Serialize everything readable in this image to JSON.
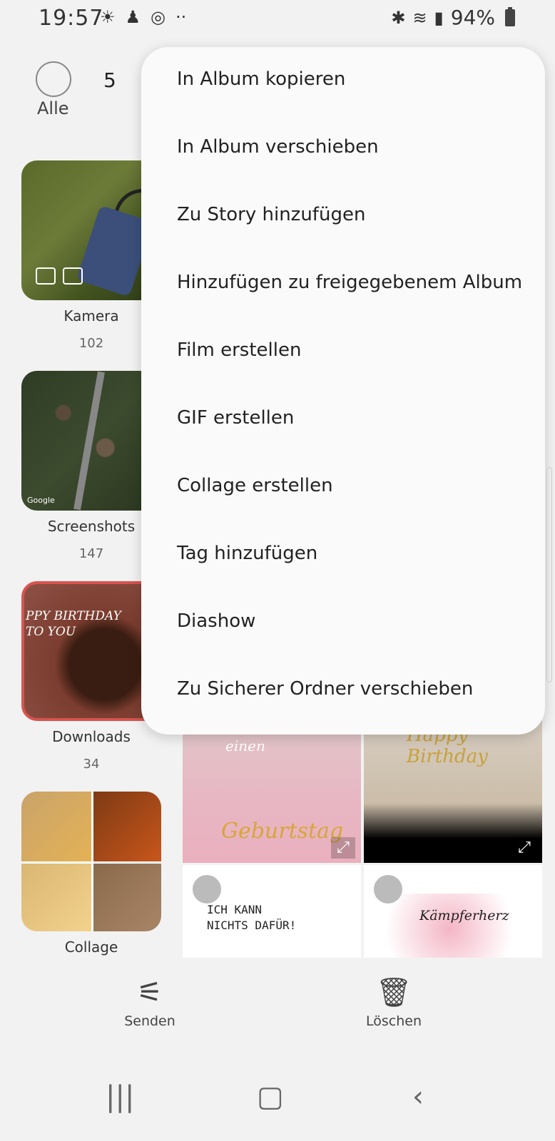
{
  "status_bar": {
    "time": "19:57",
    "left_icons": [
      "weather-icon",
      "figure-icon",
      "nfc-icon",
      "more-dots"
    ],
    "battery": "94%"
  },
  "selection": {
    "all_label": "Alle",
    "count": "5"
  },
  "albums": [
    {
      "name": "Kamera",
      "count": "102"
    },
    {
      "name": "Screenshots",
      "count": "147"
    },
    {
      "name": "Downloads",
      "count": "34"
    },
    {
      "name": "Collage",
      "count": ""
    }
  ],
  "thumb_text": {
    "screenshots_google": "Google",
    "downloads_line1": "PPY BIRTHDAY",
    "downloads_line2": "TO YOU"
  },
  "grid_text": {
    "tile1_title": "Ich wünsche dir einen",
    "tile1_big": "Geburtstag",
    "tile2_title": "Happy Birthday",
    "tile3_line1": "ICH KANN",
    "tile3_line2": "NICHTS DAFÜR!",
    "tile4_title": "Kämpferherz"
  },
  "menu": {
    "items": [
      "In Album kopieren",
      "In Album verschieben",
      "Zu Story hinzufügen",
      "Hinzufügen zu freigegebenem Album",
      "Film erstellen",
      "GIF erstellen",
      "Collage erstellen",
      "Tag hinzufügen",
      "Diashow",
      "Zu Sicherer Ordner verschieben"
    ]
  },
  "bottom_actions": {
    "send_label": "Senden",
    "delete_label": "Löschen"
  },
  "colors": {
    "background": "#f2f2f2",
    "menu_background": "#fafafa",
    "downloads_border": "#d9534f"
  }
}
